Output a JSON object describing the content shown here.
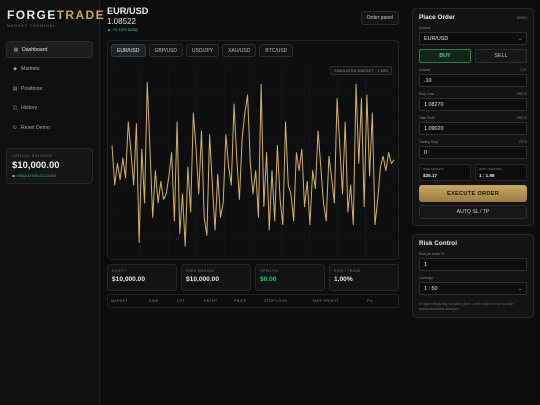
{
  "brand": {
    "name_part1": "FORGE",
    "name_part2": "TRADE",
    "subtitle": "MARKET TERMINAL"
  },
  "sidebar": {
    "items": [
      {
        "label": "Dashboard",
        "icon": "grid-icon",
        "glyph": "▦",
        "active": true
      },
      {
        "label": "Markets",
        "icon": "diamond-icon",
        "glyph": "◆",
        "active": false
      },
      {
        "label": "Positions",
        "icon": "stack-icon",
        "glyph": "▤",
        "active": false
      },
      {
        "label": "History",
        "icon": "clock-icon",
        "glyph": "◫",
        "active": false
      },
      {
        "label": "Reset Demo",
        "icon": "reset-icon",
        "glyph": "↻",
        "active": false
      }
    ],
    "balance": {
      "label": "VIRTUAL BALANCE",
      "value": "$10,000.00",
      "status": "SIMULATION ACCOUNT"
    }
  },
  "header": {
    "pair": "EUR/USD",
    "price": "1.08522",
    "change": "▲ +0.12% today",
    "order_panel_btn": "Order panel"
  },
  "tabs": [
    "EUR/USD",
    "GBP/USD",
    "USD/JPY",
    "XAU/USD",
    "BTC/USD"
  ],
  "active_tab": 0,
  "chart_badge": "SIMULATED MARKET · 1 MIN",
  "chart_data": {
    "type": "line",
    "series": [
      {
        "values": [
          0.62,
          0.4,
          0.52,
          0.43,
          0.55,
          0.44,
          0.75,
          0.58,
          0.4,
          0.74,
          0.08,
          0.6,
          0.3,
          0.97,
          0.6,
          0.22,
          0.48,
          0.3,
          0.42,
          0.32,
          0.35,
          0.45,
          0.58,
          0.2,
          0.75,
          0.13,
          0.35,
          0.06,
          0.5,
          0.25,
          0.8,
          0.6,
          0.35,
          0.7,
          0.22,
          0.12,
          0.68,
          0.4,
          0.15,
          0.46,
          0.22,
          0.3,
          0.68,
          0.5,
          0.4,
          0.85,
          0.55,
          0.32,
          0.66,
          0.8,
          0.9,
          0.52,
          0.35,
          0.48,
          0.22,
          0.96,
          0.28,
          0.58,
          0.15,
          0.48,
          0.2,
          0.62,
          0.32,
          0.18,
          0.75,
          0.4,
          0.35,
          0.2,
          0.58,
          0.48,
          0.6,
          0.28,
          0.42,
          0.18,
          0.48,
          0.38,
          0.7,
          0.5,
          0.3,
          0.2,
          0.56,
          0.44,
          0.3,
          0.88,
          0.62,
          0.35,
          0.75,
          0.25,
          0.4,
          0.18,
          0.96,
          0.52,
          0.88,
          0.28,
          0.9,
          0.45,
          0.8,
          0.18,
          0.32,
          0.5,
          0.56,
          0.48,
          0.58,
          0.52,
          0.54
        ]
      }
    ],
    "color": "#d7b06a",
    "grid": true
  },
  "stats": [
    {
      "label": "EQUITY",
      "value": "$10,000.00",
      "green": false
    },
    {
      "label": "FREE MARGIN",
      "value": "$10,000.00",
      "green": false
    },
    {
      "label": "OPEN P/L",
      "value": "$0.00",
      "green": true
    },
    {
      "label": "RISK / TRADE",
      "value": "1.00%",
      "green": false
    }
  ],
  "positions_columns": [
    "MARKET",
    "SIDE",
    "LOT",
    "ENTRY",
    "PRICE",
    "STOP LOSS",
    "TAKE PROFIT",
    "P/L"
  ],
  "order": {
    "title": "Place Order",
    "tag": "DEMO",
    "symbol_label": "Symbol",
    "symbol_value": "EUR/USD",
    "buy_label": "BUY",
    "sell_label": "SELL",
    "volume_label": "Volume",
    "volume_unit": "LOT",
    "volume_value": ".10",
    "stop_label": "Stop Loss",
    "stop_unit": "PRICE",
    "stop_value": "1.08270",
    "tp_label": "Take Profit",
    "tp_unit": "PRICE",
    "tp_value": "1.09020",
    "trailing_label": "Trailing Stop",
    "trailing_unit": "PIPS",
    "trailing_value": "0",
    "est_risk_label": "RISK AMOUNT",
    "est_risk_value": "$25.17",
    "est_rr_label": "RISK : REWARD",
    "est_rr_value": "1 : 1.98",
    "execute_label": "EXECUTE ORDER",
    "auto_label": "AUTO SL / TP"
  },
  "risk": {
    "title": "Risk Control",
    "per_trade_label": "Risk per trade %",
    "per_trade_value": "1",
    "leverage_label": "Leverage",
    "leverage_value": "1 : 50",
    "note": "En ingen rådgivning, simulerte priser. Justér risiko for å se hvordan posisjonsstørrelse beregnes."
  },
  "colors": {
    "accent": "#c9a764",
    "green": "#3fbf7f",
    "chart_line": "#d7b06a"
  }
}
